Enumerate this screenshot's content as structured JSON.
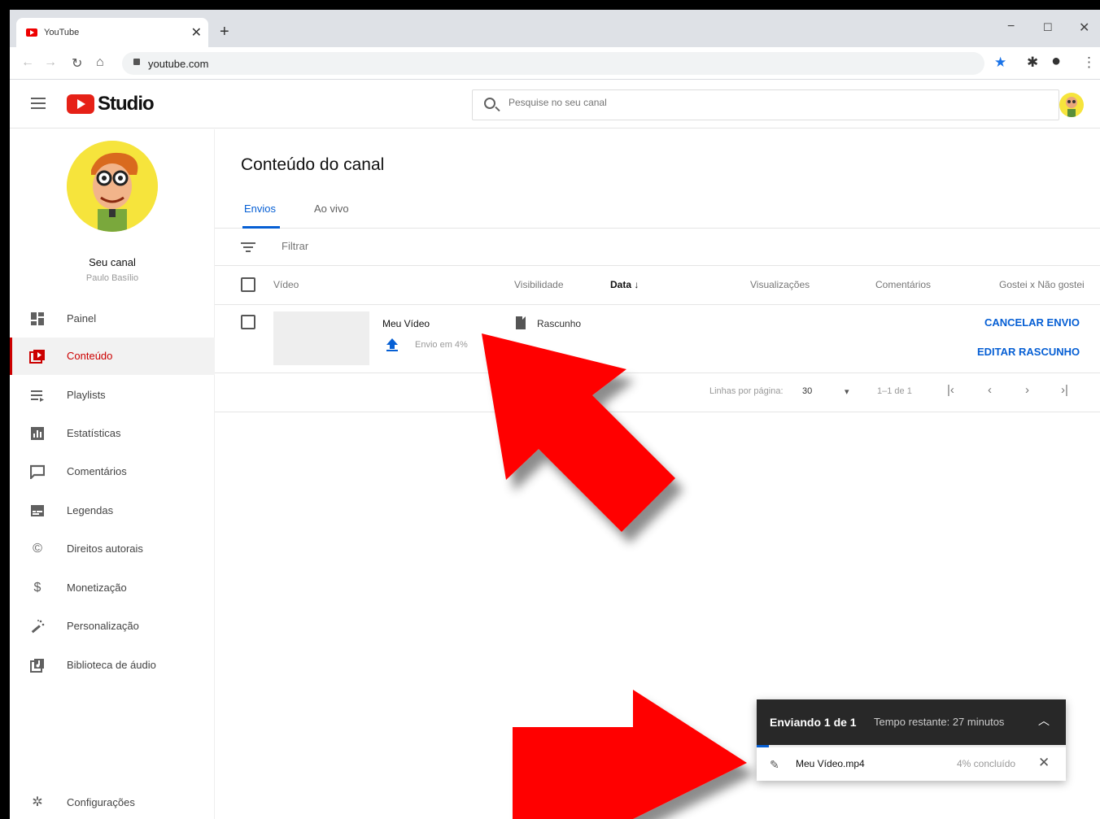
{
  "browser": {
    "tab_title": "YouTube",
    "url": "youtube.com"
  },
  "header": {
    "logo_text": "Studio",
    "search_placeholder": "Pesquise no seu canal"
  },
  "sidebar": {
    "channel_name": "Seu canal",
    "channel_owner": "Paulo Basílio",
    "items": [
      {
        "label": "Painel",
        "icon": "dashboard-icon"
      },
      {
        "label": "Conteúdo",
        "icon": "content-icon",
        "active": true
      },
      {
        "label": "Playlists",
        "icon": "playlist-icon"
      },
      {
        "label": "Estatísticas",
        "icon": "analytics-icon"
      },
      {
        "label": "Comentários",
        "icon": "comments-icon"
      },
      {
        "label": "Legendas",
        "icon": "subtitles-icon"
      },
      {
        "label": "Direitos autorais",
        "icon": "copyright-icon"
      },
      {
        "label": "Monetização",
        "icon": "dollar-icon"
      },
      {
        "label": "Personalização",
        "icon": "magic-wand-icon"
      },
      {
        "label": "Biblioteca de áudio",
        "icon": "audio-library-icon"
      }
    ],
    "settings_label": "Configurações"
  },
  "main": {
    "title": "Conteúdo do canal",
    "tabs": [
      {
        "label": "Envios",
        "active": true
      },
      {
        "label": "Ao vivo"
      }
    ],
    "filter_placeholder": "Filtrar",
    "columns": [
      "Vídeo",
      "Visibilidade",
      "Data",
      "Visualizações",
      "Comentários",
      "Gostei x Não gostei"
    ],
    "row": {
      "title": "Meu Vídeo",
      "upload_status": "Envio em 4%",
      "visibility": "Rascunho",
      "cancel_action": "CANCELAR ENVIO",
      "edit_action": "EDITAR RASCUNHO"
    },
    "pager": {
      "rows_label": "Linhas por página:",
      "rows_value": "30",
      "range": "1–1 de 1"
    }
  },
  "upload_toast": {
    "title": "Enviando 1 de 1",
    "time_left": "Tempo restante: 27 minutos",
    "file_name": "Meu Vídeo.mp4",
    "progress_label": "4% concluído",
    "progress": 0.04
  },
  "colors": {
    "brand_red": "#cc0000",
    "link_blue": "#065fd4",
    "arrow_red": "#ff0000"
  }
}
